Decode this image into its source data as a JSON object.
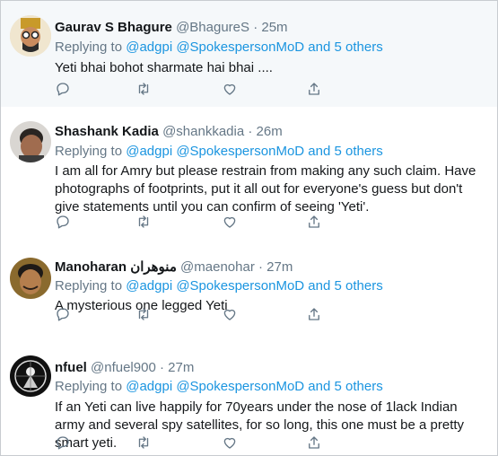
{
  "tweets": [
    {
      "name": "Gaurav S Bhagure",
      "handle": "@BhagureS",
      "time": "25m",
      "replying_prefix": "Replying to",
      "reply_to_1": "@adgpi",
      "reply_to_2": "@SpokespersonMoD",
      "reply_and": "and",
      "reply_others": "5 others",
      "text": "Yeti bhai bohot sharmate hai bhai ...."
    },
    {
      "name": "Shashank Kadia",
      "handle": "@shankkadia",
      "time": "26m",
      "replying_prefix": "Replying to",
      "reply_to_1": "@adgpi",
      "reply_to_2": "@SpokespersonMoD",
      "reply_and": "and",
      "reply_others": "5 others",
      "text": "I am all for Amry but please restrain from making any such claim. Have photographs of footprints, put it all out for everyone's guess but don't give statements until you can confirm of seeing 'Yeti'."
    },
    {
      "name": "Manoharan منوهران",
      "handle": "@maenohar",
      "time": "27m",
      "replying_prefix": "Replying to",
      "reply_to_1": "@adgpi",
      "reply_to_2": "@SpokespersonMoD",
      "reply_and": "and",
      "reply_others": "5 others",
      "text": "A mysterious one legged Yeti"
    },
    {
      "name": "nfuel",
      "handle": "@nfuel900",
      "time": "27m",
      "replying_prefix": "Replying to",
      "reply_to_1": "@adgpi",
      "reply_to_2": "@SpokespersonMoD",
      "reply_and": "and",
      "reply_others": "5 others",
      "text": "If an Yeti can live happily for 70years under the nose of 1lack Indian army and several spy satellites, for so long, this one must be a pretty smart yeti."
    }
  ],
  "separator": "·",
  "icons": [
    "reply-icon",
    "retweet-icon",
    "like-icon",
    "share-icon"
  ],
  "colors": {
    "link": "#1b95e0",
    "secondary": "#657786",
    "highlight_bg": "#f5f8fa",
    "icon": "#657786"
  }
}
